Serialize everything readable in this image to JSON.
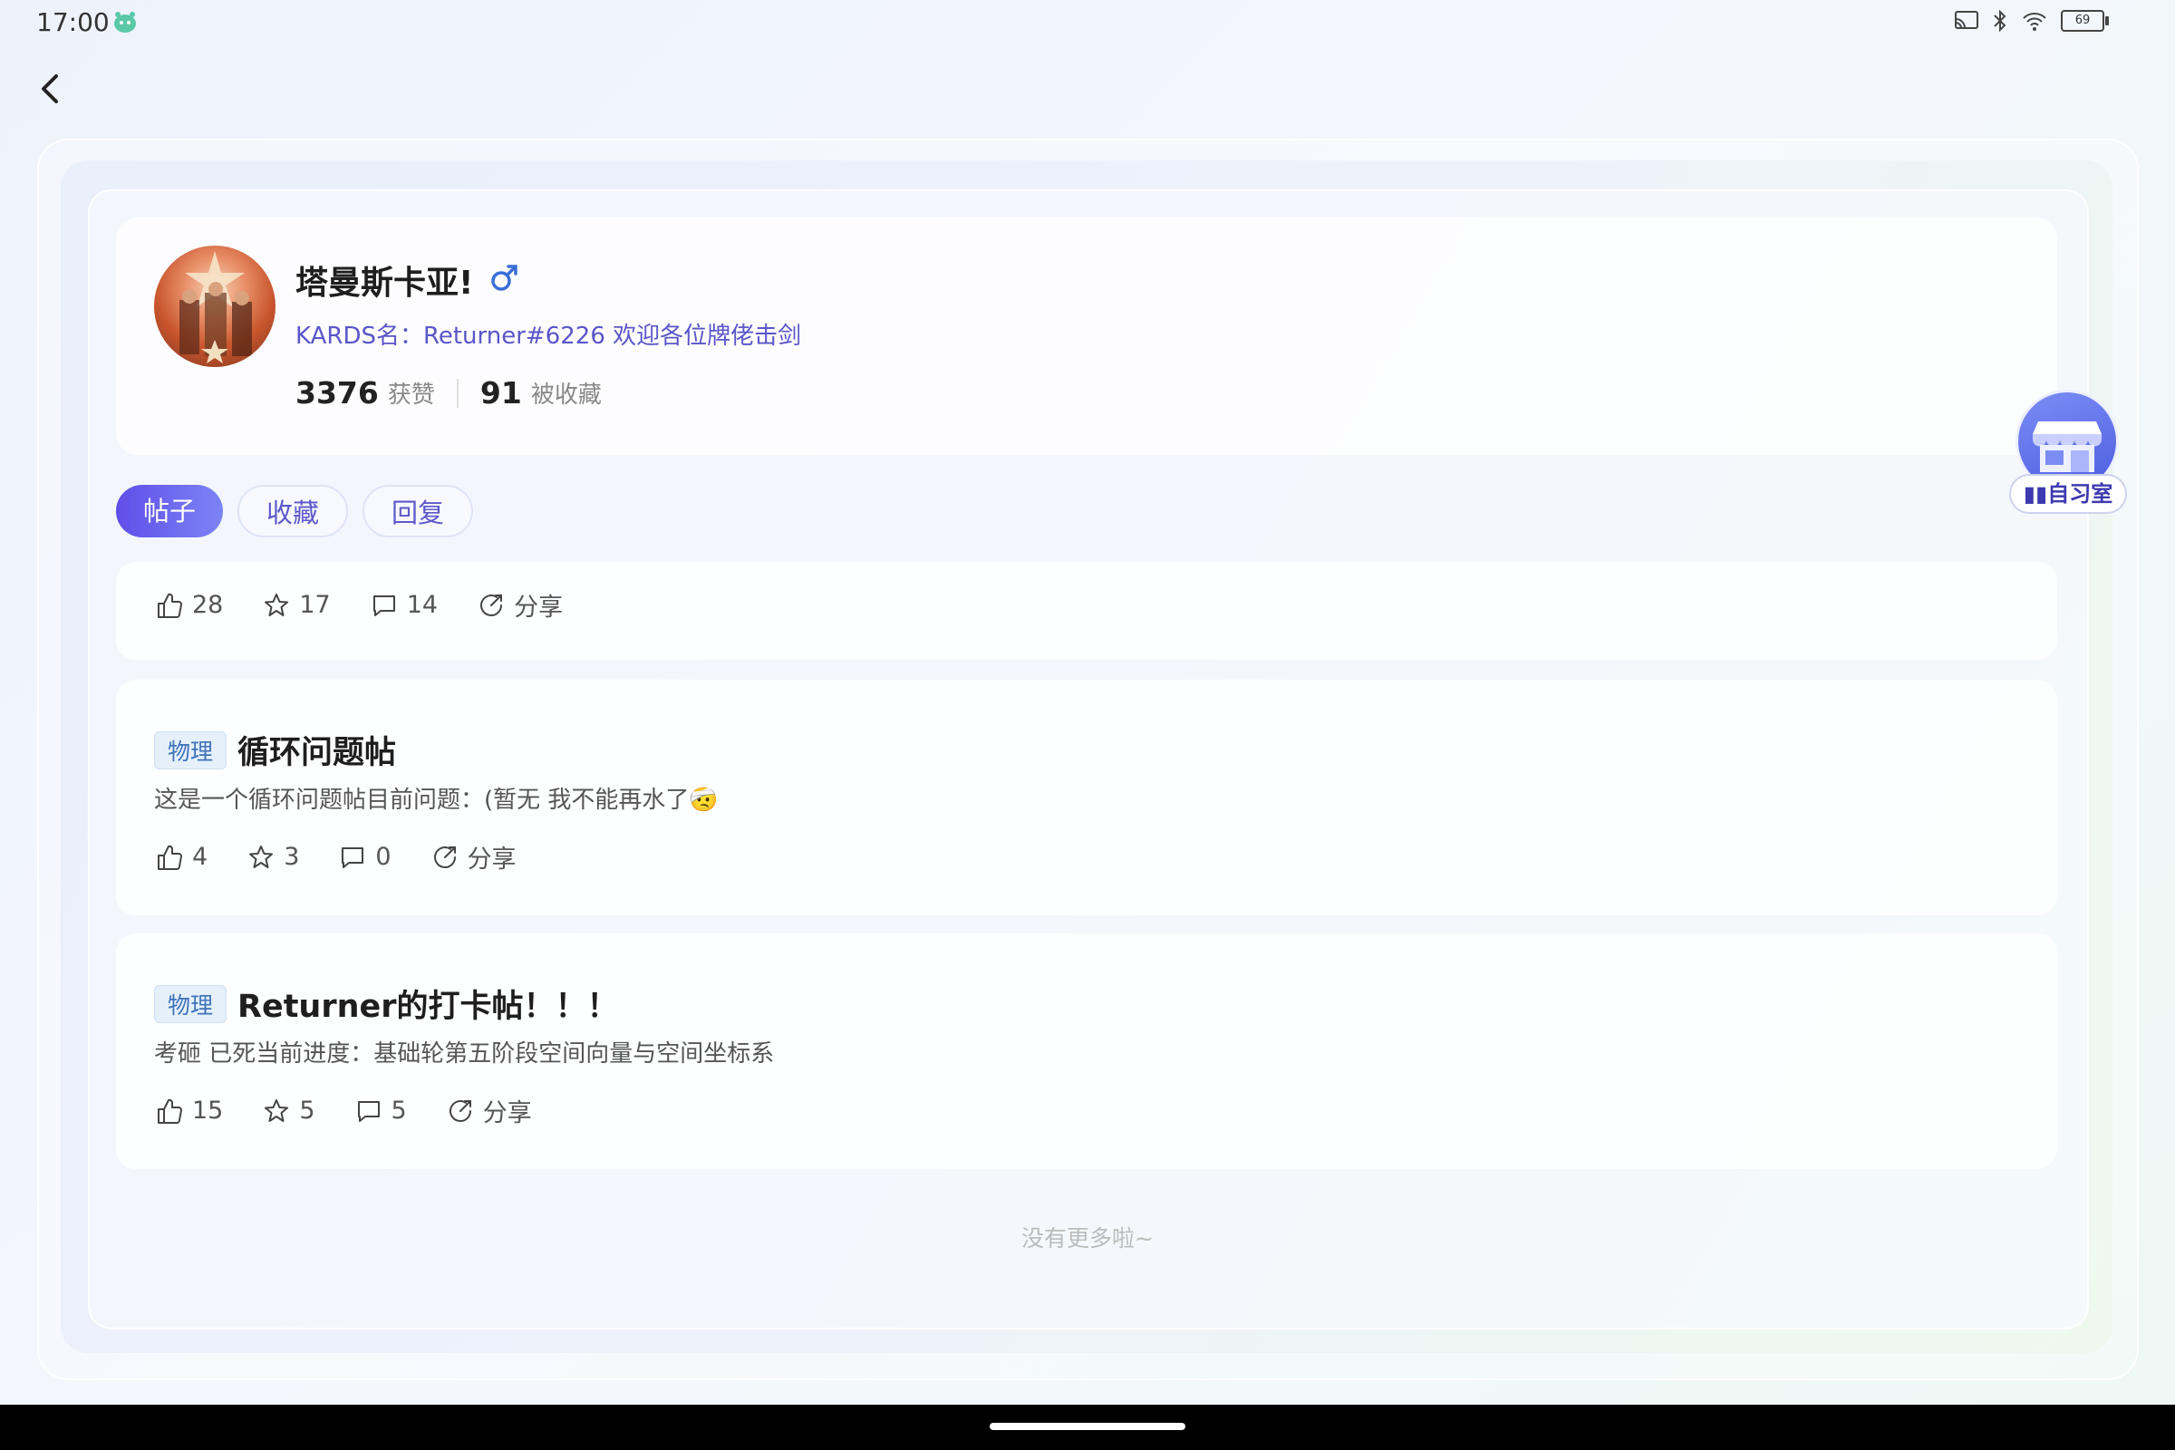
{
  "status": {
    "time": "17:00",
    "battery": "69"
  },
  "profile": {
    "name": "塔曼斯卡亚!",
    "gender_symbol": "♂",
    "bio": "KARDS名：Returner#6226 欢迎各位牌佬击剑",
    "likes_count": "3376",
    "likes_label": "获赞",
    "saved_count": "91",
    "saved_label": "被收藏"
  },
  "tabs": [
    {
      "label": "帖子",
      "active": true
    },
    {
      "label": "收藏",
      "active": false
    },
    {
      "label": "回复",
      "active": false
    }
  ],
  "float_button": {
    "label": "自习室"
  },
  "posts": [
    {
      "likes": "28",
      "stars": "17",
      "comments": "14",
      "share": "分享"
    },
    {
      "tag": "物理",
      "title": "循环问题帖",
      "excerpt": "这是一个循环问题帖目前问题：(暂无 我不能再水了🤕",
      "likes": "4",
      "stars": "3",
      "comments": "0",
      "share": "分享"
    },
    {
      "tag": "物理",
      "title": "Returner的打卡帖！！！",
      "excerpt": "考砸 已死当前进度：基础轮第五阶段空间向量与空间坐标系",
      "likes": "15",
      "stars": "5",
      "comments": "5",
      "share": "分享"
    }
  ],
  "footer": {
    "no_more": "没有更多啦~"
  },
  "colors": {
    "accent": "#5f4ee8",
    "bio": "#5a55c8",
    "tag": "#3e73b8"
  }
}
